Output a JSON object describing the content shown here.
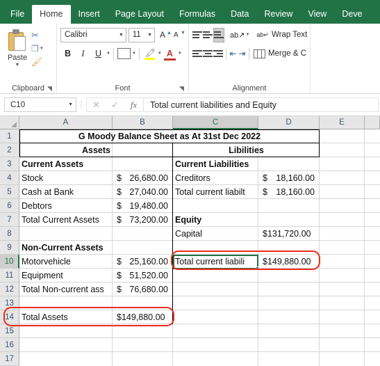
{
  "ribbon": {
    "tabs": [
      {
        "label": "File",
        "active": false
      },
      {
        "label": "Home",
        "active": true
      },
      {
        "label": "Insert",
        "active": false
      },
      {
        "label": "Page Layout",
        "active": false
      },
      {
        "label": "Formulas",
        "active": false
      },
      {
        "label": "Data",
        "active": false
      },
      {
        "label": "Review",
        "active": false
      },
      {
        "label": "View",
        "active": false
      },
      {
        "label": "Deve",
        "active": false
      }
    ],
    "clipboard": {
      "group_label": "Clipboard",
      "paste_label": "Paste",
      "cut_icon": "scissors-icon",
      "copy_icon": "copy-icon",
      "format_painter_icon": "format-painter-icon"
    },
    "font": {
      "group_label": "Font",
      "font_name": "Calibri",
      "font_size": "11",
      "grow_font_icon": "grow-font-icon",
      "shrink_font_icon": "shrink-font-icon",
      "bold": "B",
      "italic": "I",
      "underline": "U",
      "borders_icon": "borders-icon",
      "fill_color_icon": "fill-color-icon",
      "font_color_icon": "font-color-icon"
    },
    "alignment": {
      "group_label": "Alignment",
      "wrap_text_label": "Wrap Text",
      "merge_label": "Merge & C",
      "top_align_icon": "align-top-icon",
      "middle_align_icon": "align-middle-icon",
      "bottom_align_icon": "align-bottom-icon",
      "orientation_icon": "orientation-icon",
      "align_left_icon": "align-left-icon",
      "align_center_icon": "align-center-icon",
      "align_right_icon": "align-right-icon",
      "decrease_indent_icon": "decrease-indent-icon",
      "increase_indent_icon": "increase-indent-icon"
    }
  },
  "formula_bar": {
    "name_box": "C10",
    "cancel_icon": "cancel-icon",
    "enter_icon": "confirm-icon",
    "function_icon": "insert-function-icon",
    "formula_value": "Total current liabilities and Equity"
  },
  "grid": {
    "columns": [
      "A",
      "B",
      "C",
      "D",
      "E"
    ],
    "active_column": "C",
    "rows": [
      "1",
      "2",
      "3",
      "4",
      "5",
      "6",
      "7",
      "8",
      "9",
      "10",
      "11",
      "12",
      "13",
      "14",
      "15",
      "16",
      "17"
    ],
    "active_row": "10",
    "selected_cell": "C10",
    "cells": {
      "title": "G Moody Balance Sheet as At 31st Dec 2022",
      "assets_header": "Assets",
      "liabilities_header": "Libilities",
      "a3": "Current Assets",
      "c3": "Current Liabilities",
      "a4": "Stock",
      "b4_sym": "$",
      "b4_val": "26,680.00",
      "c4": "Creditors",
      "d4_sym": "$",
      "d4_val": "18,160.00",
      "a5": "Cash at Bank",
      "b5_sym": "$",
      "b5_val": "27,040.00",
      "c5": "Total current liabilt",
      "d5_sym": "$",
      "d5_val": "18,160.00",
      "a6": "Debtors",
      "b6_sym": "$",
      "b6_val": "19,480.00",
      "a7": "Total Current Assets",
      "b7_sym": "$",
      "b7_val": "73,200.00",
      "c7": "Equity",
      "c8": "Capital",
      "d8": "$131,720.00",
      "a9": "Non-Current Assets",
      "a10": "Motorvehicle",
      "b10_sym": "$",
      "b10_val": "25,160.00",
      "c10": "Total current liabili",
      "d10": "$149,880.00",
      "a11": "Equipment",
      "b11_sym": "$",
      "b11_val": "51,520.00",
      "a12": "Total Non-current ass",
      "b12_sym": "$",
      "b12_val": "76,680.00",
      "a14": "Total Assets",
      "b14": "$149,880.00"
    }
  },
  "annotations": {
    "accent_red": "#ee2b1c",
    "selection_green": "#217346",
    "highlight_1": "C10-D10-row-highlight",
    "highlight_2": "A14-B14-row-highlight"
  }
}
